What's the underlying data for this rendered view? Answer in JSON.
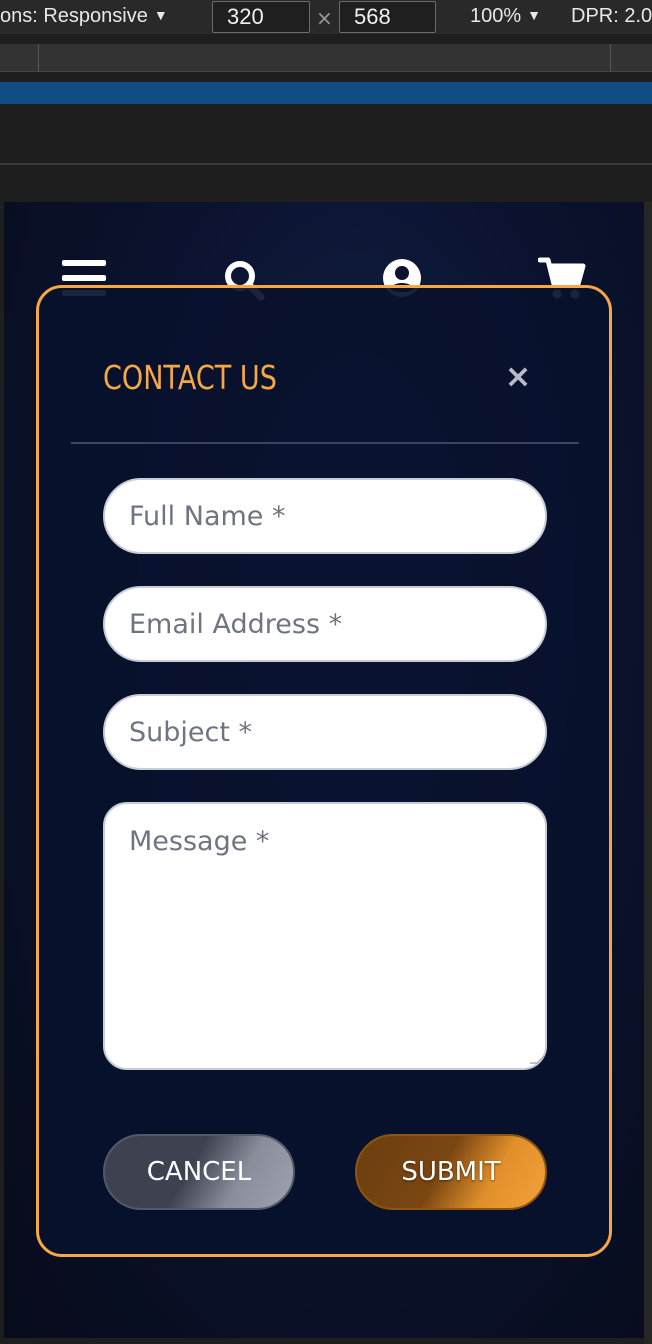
{
  "devtools": {
    "device_label": "ons: Responsive",
    "device_caret": "▼",
    "width_value": "320",
    "height_value": "568",
    "times": "×",
    "zoom_label": "100%",
    "zoom_caret": "▼",
    "dpr_label": "DPR: 2.0"
  },
  "nav": {
    "icons": [
      "menu-icon",
      "search-icon",
      "user-account-icon",
      "shopping-cart-icon"
    ]
  },
  "modal": {
    "title": "CONTACT US",
    "close_label": "×",
    "fields": {
      "full_name_placeholder": "Full Name *",
      "email_placeholder": "Email Address *",
      "subject_placeholder": "Subject *",
      "message_placeholder": "Message *"
    },
    "cancel_label": "CANCEL",
    "submit_label": "SUBMIT"
  },
  "colors": {
    "accent": "#f5a844",
    "background": "#0b1330",
    "field_bg": "#ffffff"
  }
}
